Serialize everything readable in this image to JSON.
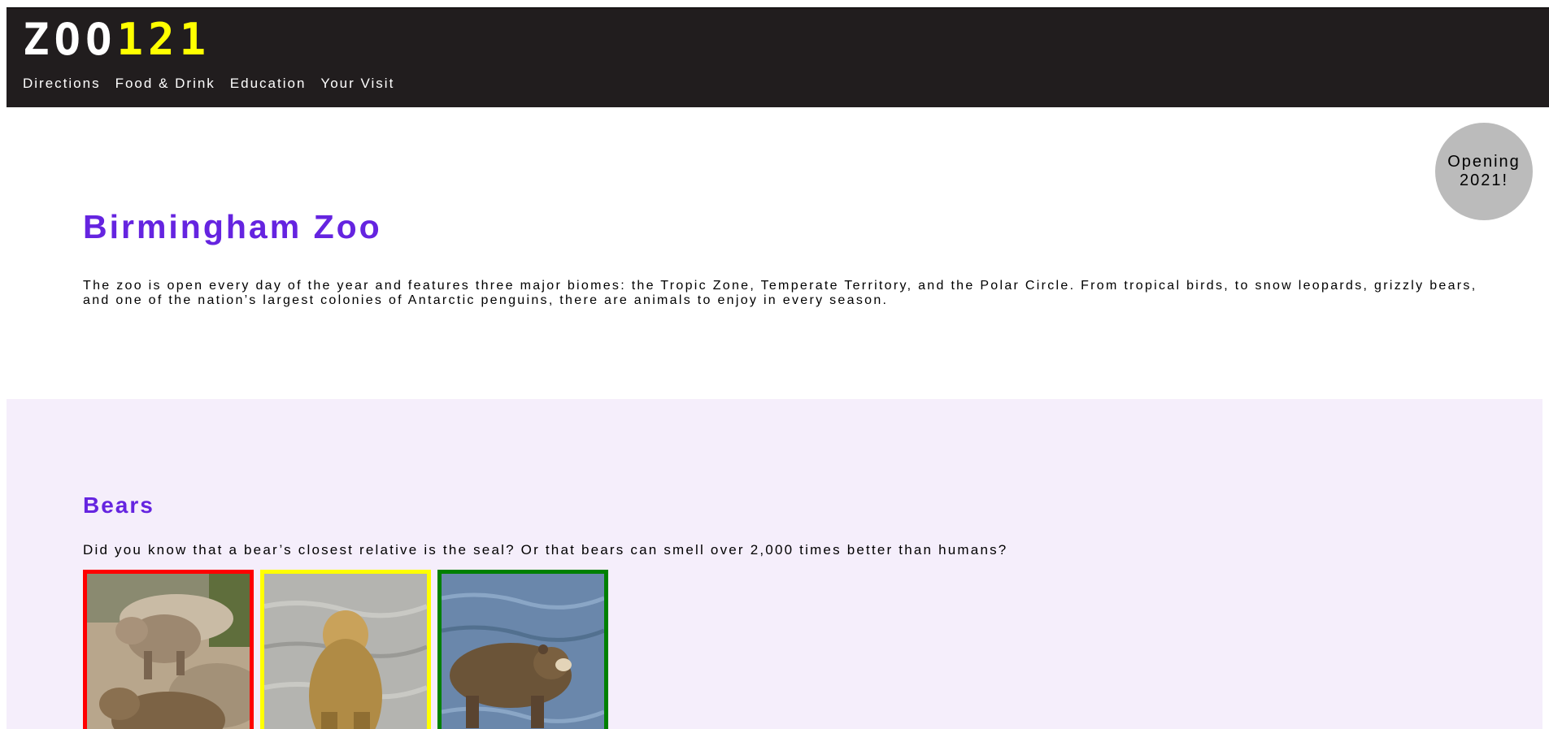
{
  "header": {
    "logo_part_a": "ZOO",
    "logo_part_b": "121",
    "nav": [
      {
        "label": "Directions"
      },
      {
        "label": "Food & Drink"
      },
      {
        "label": "Education"
      },
      {
        "label": "Your Visit"
      }
    ]
  },
  "badge": {
    "text": "Opening 2021!"
  },
  "intro": {
    "title": "Birmingham Zoo",
    "text": "The zoo is open every day of the year and features three major biomes: the Tropic Zone, Temperate Territory, and the Polar Circle. From tropical birds, to snow leopards, grizzly bears, and one of the nation’s largest colonies of Antarctic penguins, there are animals to enjoy in every season."
  },
  "bears": {
    "title": "Bears",
    "text": "Did you know that a bear’s closest relative is the seal? Or that bears can smell over 2,000 times better than humans?",
    "photos": [
      {
        "name": "bear-photo-1",
        "border_color": "#ff0000"
      },
      {
        "name": "bear-photo-2",
        "border_color": "#ffff00"
      },
      {
        "name": "bear-photo-3",
        "border_color": "#008000"
      }
    ]
  },
  "colors": {
    "header_bg": "#211d1e",
    "accent_purple": "#6524e0",
    "section_bg": "#f5eefb",
    "badge_bg": "#bbbbbb",
    "logo_yellow": "#ffff00"
  }
}
